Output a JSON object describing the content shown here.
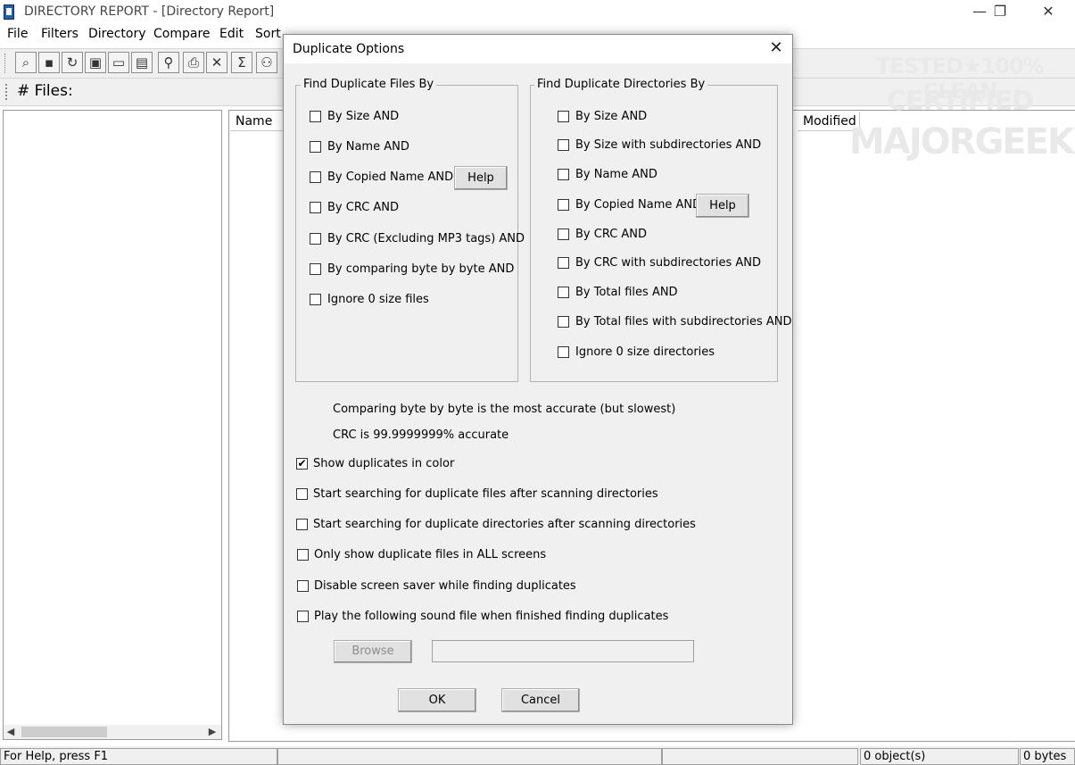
{
  "window": {
    "title": "DIRECTORY REPORT - [Directory Report]",
    "minimize_glyph": "—",
    "restore_glyph": "❐",
    "close_glyph": "✕"
  },
  "menu": [
    "File",
    "Filters",
    "Directory",
    "Compare",
    "Edit",
    "Sort"
  ],
  "toolbar": {
    "buttons": [
      {
        "icon": "binoculars-icon",
        "glyph": "⌕"
      },
      {
        "icon": "save-icon",
        "glyph": "▪"
      },
      {
        "icon": "refresh-icon",
        "glyph": "↻"
      },
      {
        "icon": "camera-icon",
        "glyph": "▣"
      },
      {
        "icon": "open-folder-icon",
        "glyph": "▭"
      },
      {
        "icon": "folders-icon",
        "glyph": "▤"
      },
      {
        "icon": "find-icon",
        "glyph": "⚲"
      },
      {
        "icon": "print-icon",
        "glyph": "⎙"
      },
      {
        "icon": "delete-icon",
        "glyph": "✕"
      },
      {
        "icon": "sum-icon",
        "glyph": "Σ"
      },
      {
        "icon": "users-icon",
        "glyph": "⚇"
      }
    ]
  },
  "files_bar": {
    "label": "# Files:"
  },
  "file_list": {
    "columns": [
      "Name",
      "Modified"
    ]
  },
  "status_bar": {
    "help": "For Help, press F1",
    "objects": "0 object(s)",
    "bytes": "0 bytes"
  },
  "watermark": {
    "line1": "TESTED★100% CLEAN",
    "line2": "CERTIFIED",
    "line3": "MAJORGEEKS"
  },
  "dialog": {
    "title": "Duplicate Options",
    "close_glyph": "✕",
    "files_group": {
      "title": "Find Duplicate Files By",
      "options": [
        {
          "label": "By Size  AND",
          "checked": false
        },
        {
          "label": "By Name  AND",
          "checked": false
        },
        {
          "label": "By Copied Name  AND",
          "checked": false
        },
        {
          "label": "By CRC  AND",
          "checked": false
        },
        {
          "label": "By CRC (Excluding MP3 tags)  AND",
          "checked": false
        },
        {
          "label": "By comparing byte by byte  AND",
          "checked": false
        },
        {
          "label": "Ignore 0 size files",
          "checked": false
        }
      ],
      "help_label": "Help"
    },
    "dirs_group": {
      "title": "Find Duplicate Directories By",
      "options": [
        {
          "label": "By Size  AND",
          "checked": false
        },
        {
          "label": "By Size with subdirectories  AND",
          "checked": false
        },
        {
          "label": "By Name  AND",
          "checked": false
        },
        {
          "label": "By Copied Name  AND",
          "checked": false
        },
        {
          "label": "By CRC  AND",
          "checked": false
        },
        {
          "label": "By CRC with subdirectories  AND",
          "checked": false
        },
        {
          "label": "By Total files  AND",
          "checked": false
        },
        {
          "label": "By Total files with subdirectories  AND",
          "checked": false
        },
        {
          "label": "Ignore 0 size directories",
          "checked": false
        }
      ],
      "help_label": "Help"
    },
    "note1": "Comparing byte by byte is the most accurate (but slowest)",
    "note2": "CRC is 99.9999999% accurate",
    "options": [
      {
        "label": "Show duplicates in color",
        "checked": true
      },
      {
        "label": "Start searching for duplicate files after scanning directories",
        "checked": false
      },
      {
        "label": "Start searching for duplicate directories after scanning directories",
        "checked": false
      },
      {
        "label": "Only show duplicate files in ALL screens",
        "checked": false
      },
      {
        "label": "Disable screen saver while finding duplicates",
        "checked": false
      },
      {
        "label": "Play the following sound file when finished finding duplicates",
        "checked": false
      }
    ],
    "browse_label": "Browse",
    "sound_path": "",
    "ok_label": "OK",
    "cancel_label": "Cancel"
  }
}
